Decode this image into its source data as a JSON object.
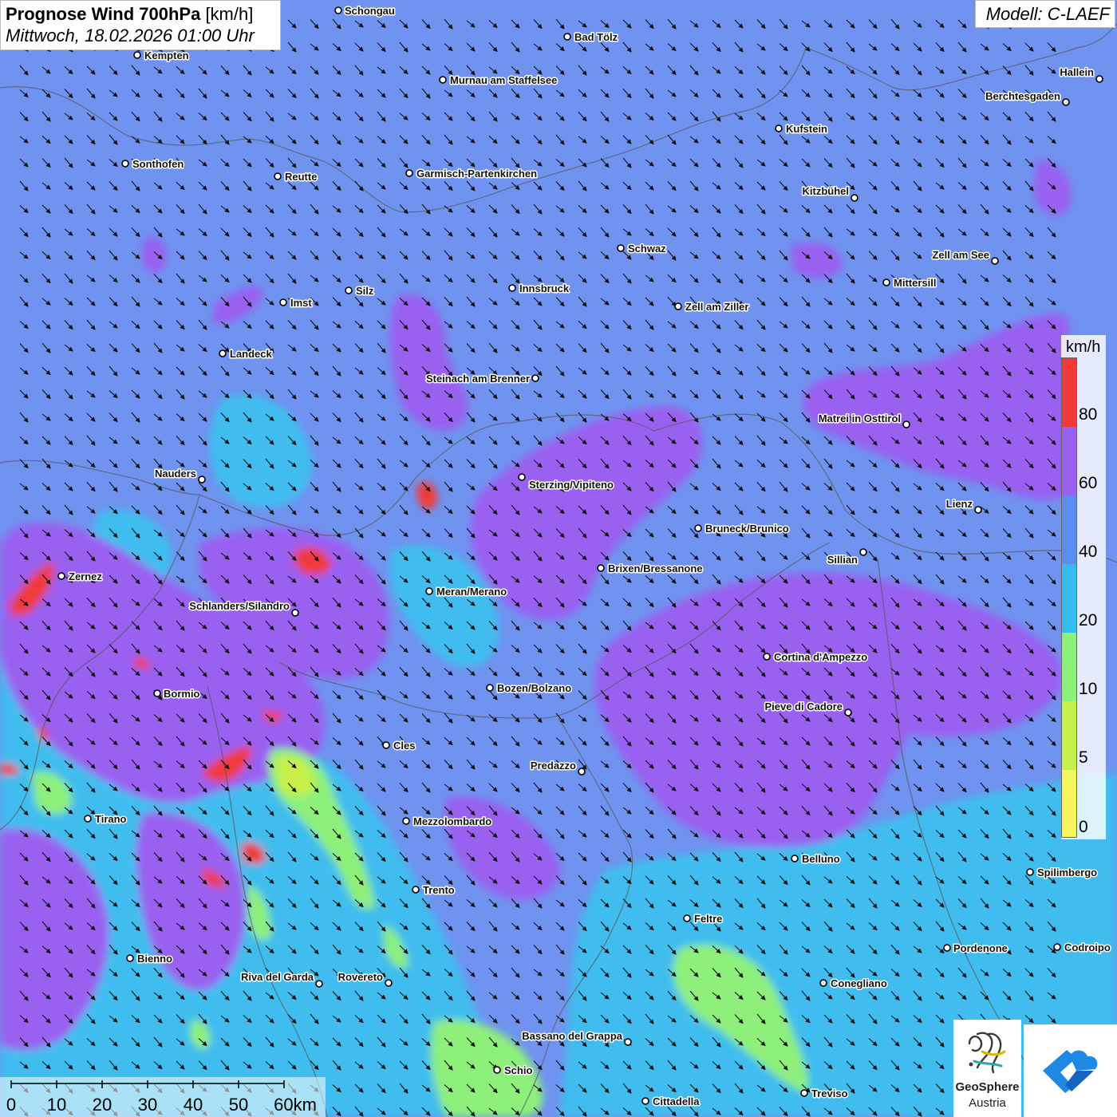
{
  "header": {
    "title": "Prognose Wind 700hPa",
    "unit": "[km/h]",
    "datetime": "Mittwoch, 18.02.2026 01:00 Uhr",
    "model": "Modell: C-LAEF"
  },
  "legend": {
    "unit": "km/h",
    "items": [
      {
        "label": "80",
        "color": "#f03a3a"
      },
      {
        "label": "60",
        "color": "#9a60f0"
      },
      {
        "label": "40",
        "color": "#5b8cf0"
      },
      {
        "label": "20",
        "color": "#33bdee"
      },
      {
        "label": "10",
        "color": "#8ef07a"
      },
      {
        "label": "5",
        "color": "#c6f04a"
      },
      {
        "label": "0",
        "color": "#f6f65c"
      }
    ]
  },
  "scale": {
    "labels": [
      "0",
      "10",
      "20",
      "30",
      "40",
      "50",
      "60km"
    ]
  },
  "logos": {
    "geosphere_line1": "GeoSphere",
    "geosphere_line2": "Austria",
    "geosphere_icon": "geosphere-swirl-icon",
    "partner_icon": "blue-chevron-cloud-icon"
  },
  "colors": {
    "background_wind_40_60": "#6f93ef",
    "zone_60_80": "#9a60f0",
    "zone_20_40": "#40bdee",
    "zone_10_20": "#8ef07a",
    "zone_5_10": "#c6f04a",
    "zone_80_plus": "#f03a3a",
    "arrow": "#111111",
    "border": "#555555"
  },
  "wind_arrow_icon": "wind-arrow-southeast-icon",
  "cities": [
    {
      "name": "Schongau"
    },
    {
      "name": "Bad Tölz"
    },
    {
      "name": "Kempten"
    },
    {
      "name": "Murnau am Staffelsee"
    },
    {
      "name": "Hallein"
    },
    {
      "name": "Berchtesgaden"
    },
    {
      "name": "Kufstein"
    },
    {
      "name": "Sonthofen"
    },
    {
      "name": "Reutte"
    },
    {
      "name": "Garmisch-Partenkirchen"
    },
    {
      "name": "Kitzbühel"
    },
    {
      "name": "Schwaz"
    },
    {
      "name": "Zell am See"
    },
    {
      "name": "Mittersill"
    },
    {
      "name": "Silz"
    },
    {
      "name": "Innsbruck"
    },
    {
      "name": "Imst"
    },
    {
      "name": "Zell am Ziller"
    },
    {
      "name": "Landeck"
    },
    {
      "name": "Steinach am Brenner"
    },
    {
      "name": "Matrei in Osttirol"
    },
    {
      "name": "Nauders"
    },
    {
      "name": "Sterzing/Vipiteno"
    },
    {
      "name": "Lienz"
    },
    {
      "name": "Bruneck/Brunico"
    },
    {
      "name": "Sillian"
    },
    {
      "name": "Zernez"
    },
    {
      "name": "Brixen/Bressanone"
    },
    {
      "name": "Meran/Merano"
    },
    {
      "name": "Schlanders/Silandro"
    },
    {
      "name": "Cortina d'Ampezzo"
    },
    {
      "name": "Bozen/Bolzano"
    },
    {
      "name": "Bormio"
    },
    {
      "name": "Pieve di Cadore"
    },
    {
      "name": "Cles"
    },
    {
      "name": "Predazzo"
    },
    {
      "name": "Tirano"
    },
    {
      "name": "Mezzolombardo"
    },
    {
      "name": "Belluno"
    },
    {
      "name": "Spilimbergo"
    },
    {
      "name": "Trento"
    },
    {
      "name": "Feltre"
    },
    {
      "name": "Pordenone"
    },
    {
      "name": "Codroipo"
    },
    {
      "name": "Bienno"
    },
    {
      "name": "Riva del Garda"
    },
    {
      "name": "Rovereto"
    },
    {
      "name": "Conegliano"
    },
    {
      "name": "Bassano del Grappa"
    },
    {
      "name": "Schio"
    },
    {
      "name": "Treviso"
    },
    {
      "name": "Cittadella"
    }
  ]
}
